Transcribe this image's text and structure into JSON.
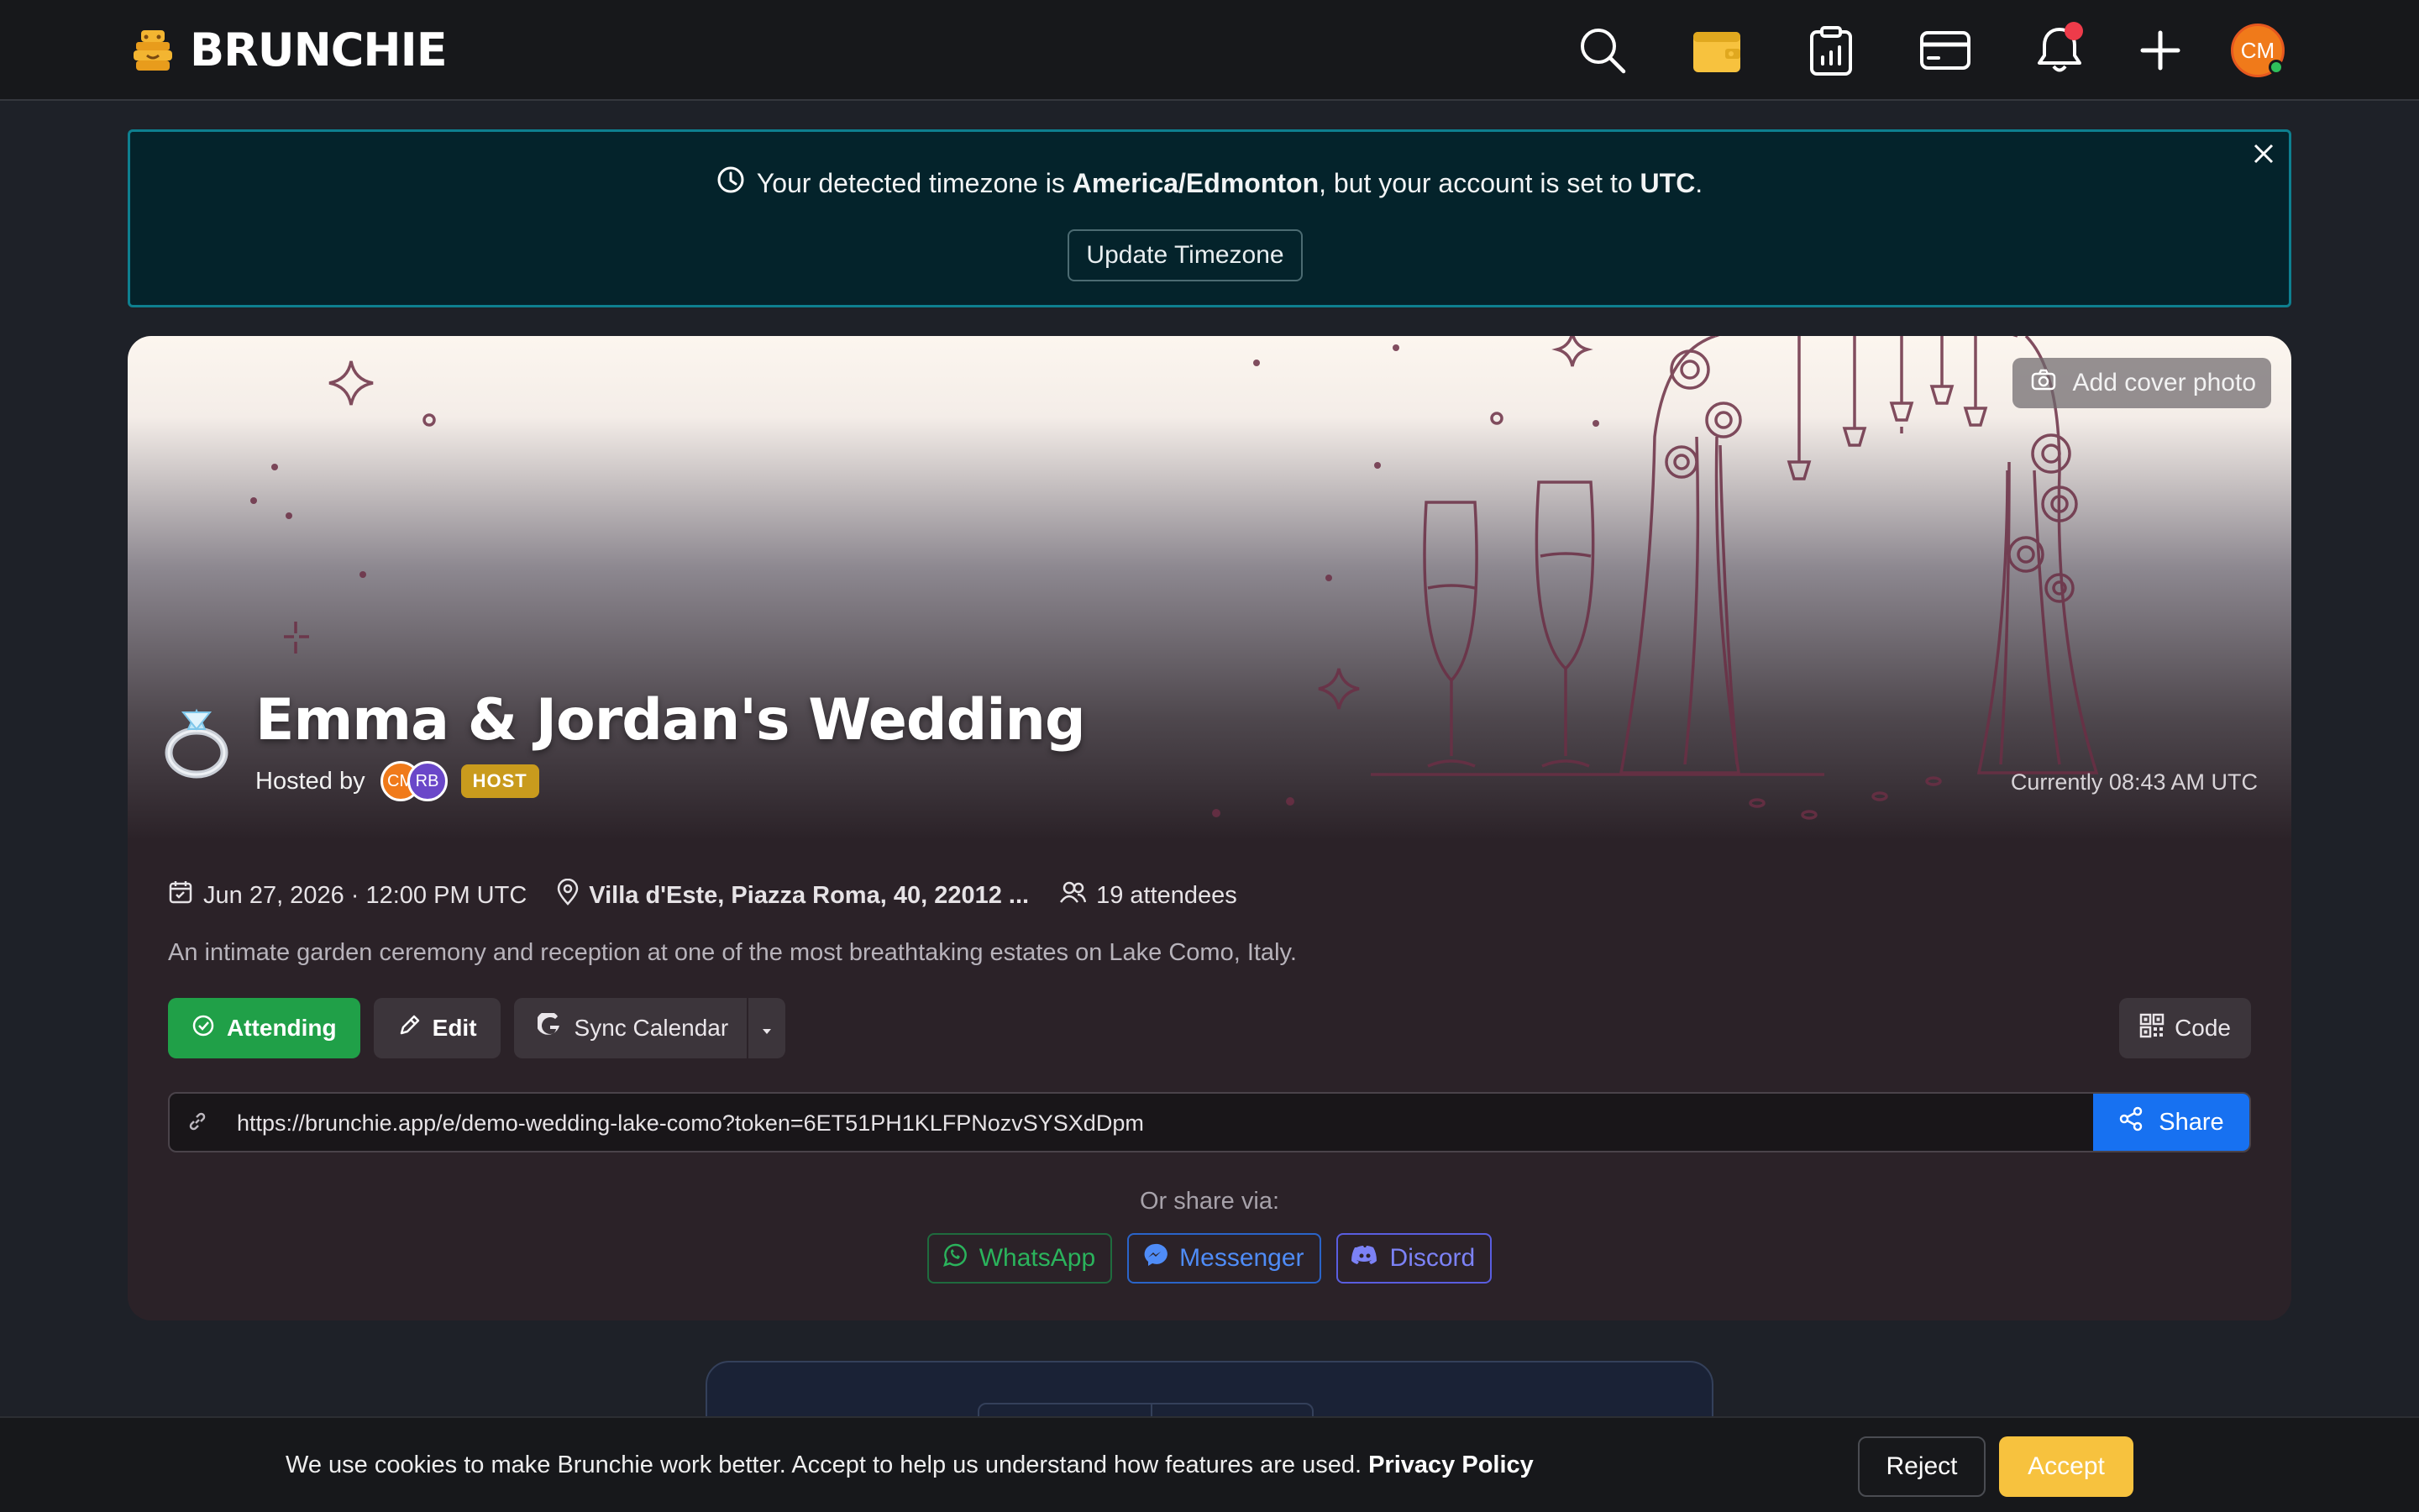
{
  "app": {
    "brand": "BRUNCHIE"
  },
  "nav": {
    "icons": [
      "search-icon",
      "calendar-wallet-icon",
      "clipboard-chart-icon",
      "card-icon",
      "bell-icon",
      "plus-icon"
    ],
    "avatar_initials": "CM",
    "colors": {
      "wallet": "#f7c23e",
      "notif": "#ee3b4a"
    }
  },
  "tz_banner": {
    "prefix": "Your detected timezone is",
    "detected": "America/Edmonton",
    "middle": ", but your account is set to",
    "account": "UTC",
    "suffix": ".",
    "button": "Update Timezone"
  },
  "event": {
    "add_cover": "Add cover photo",
    "title": "Emma & Jordan's Wedding",
    "hosted_by": "Hosted by",
    "hosts": [
      "CM",
      "RB"
    ],
    "host_badge": "HOST",
    "current_time": "Currently 08:43 AM UTC",
    "date": "Jun 27, 2026 · 12:00 PM UTC",
    "location": "Villa d'Este, Piazza Roma, 40, 22012 ...",
    "attendees": "19 attendees",
    "description": "An intimate garden ceremony and reception at one of the most breathtaking estates on Lake Como, Italy.",
    "actions": {
      "attending": "Attending",
      "edit": "Edit",
      "sync": "Sync Calendar",
      "code": "Code"
    },
    "share": {
      "url": "https://brunchie.app/e/demo-wedding-lake-como?token=6ET51PH1KLFPNozvSYSXdDpm",
      "button": "Share",
      "via_label": "Or share via:",
      "options": [
        "WhatsApp",
        "Messenger",
        "Discord"
      ]
    }
  },
  "cookie": {
    "text": "We use cookies to make Brunchie work better. Accept to help us understand how features are used.",
    "policy": "Privacy Policy",
    "reject": "Reject",
    "accept": "Accept"
  }
}
